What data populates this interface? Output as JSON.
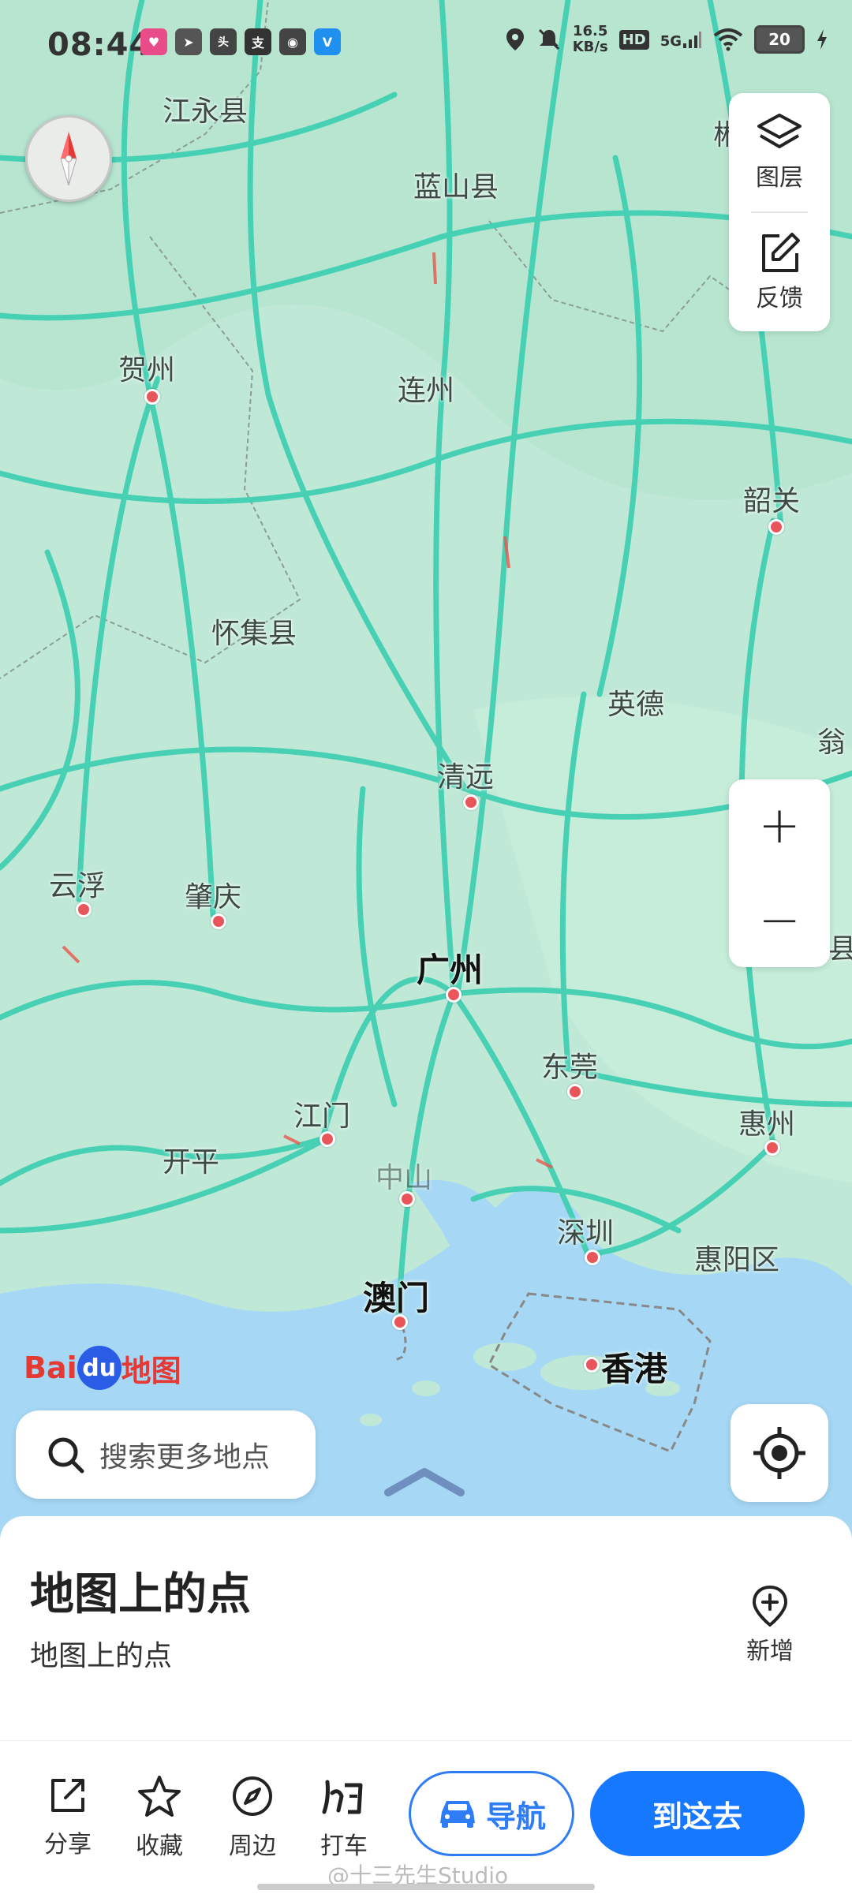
{
  "status_bar": {
    "time": "08:44",
    "net_speed_value": "16.5",
    "net_speed_unit": "KB/s",
    "hd_label": "HD",
    "signal_label": "5G",
    "battery": "20",
    "app_icons": [
      "toutiao-icon",
      "telegram-icon",
      "headline-icon",
      "alipay-icon",
      "app-icon",
      "vw-icon"
    ]
  },
  "map": {
    "labels": [
      {
        "text": "江永县",
        "type": "county"
      },
      {
        "text": "蓝山县",
        "type": "county"
      },
      {
        "text": "贺州",
        "type": "city"
      },
      {
        "text": "连州",
        "type": "county"
      },
      {
        "text": "韶关",
        "type": "city"
      },
      {
        "text": "怀集县",
        "type": "county"
      },
      {
        "text": "英德",
        "type": "county"
      },
      {
        "text": "清远",
        "type": "city"
      },
      {
        "text": "云浮",
        "type": "city"
      },
      {
        "text": "肇庆",
        "type": "city"
      },
      {
        "text": "广州",
        "type": "major"
      },
      {
        "text": "东莞",
        "type": "city"
      },
      {
        "text": "江门",
        "type": "city"
      },
      {
        "text": "开平",
        "type": "county"
      },
      {
        "text": "惠州",
        "type": "city"
      },
      {
        "text": "中山",
        "type": "city"
      },
      {
        "text": "深圳",
        "type": "city"
      },
      {
        "text": "惠阳区",
        "type": "county"
      },
      {
        "text": "澳门",
        "type": "major"
      },
      {
        "text": "香港",
        "type": "major"
      },
      {
        "text": "郴",
        "type": "edge"
      },
      {
        "text": "翁",
        "type": "edge"
      },
      {
        "text": "县",
        "type": "edge"
      }
    ],
    "colors": {
      "land": "#bfe8d6",
      "water": "#a6d8f5",
      "road": "#41cfb3"
    }
  },
  "controls": {
    "layers_label": "图层",
    "feedback_label": "反馈",
    "zoom_in": "+",
    "zoom_out": "−"
  },
  "brand": {
    "part1": "Bai",
    "part2": "du",
    "part3": "地图"
  },
  "search": {
    "placeholder": "搜索更多地点"
  },
  "sheet": {
    "title": "地图上的点",
    "subtitle": "地图上的点",
    "add_label": "新增"
  },
  "bottom_bar": {
    "share": "分享",
    "favorite": "收藏",
    "nearby": "周边",
    "taxi": "打车",
    "navigate": "导航",
    "go_here": "到这去"
  },
  "watermark": "@十三先生Studio"
}
